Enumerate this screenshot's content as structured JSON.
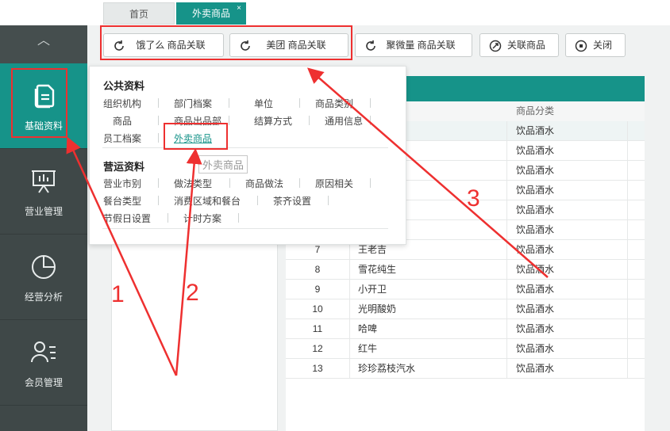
{
  "tabs": {
    "home": "首页",
    "active": "外卖商品",
    "close": "×"
  },
  "sidebar": {
    "collapse": "︿",
    "items": [
      {
        "label": "基础资料"
      },
      {
        "label": "营业管理"
      },
      {
        "label": "经营分析"
      },
      {
        "label": "会员管理"
      }
    ]
  },
  "toolbar": {
    "eleme": "饿了么 商品关联",
    "meituan": "美团 商品关联",
    "juweiliang": "聚微量 商品关联",
    "link_goods": "关联商品",
    "close": "关闭"
  },
  "menu": {
    "public_title": "公共资料",
    "public_row1": [
      "组织机构",
      "部门档案",
      "单位",
      "商品类别"
    ],
    "public_row2": [
      "商品",
      "商品出品部",
      "结算方式",
      "通用信息"
    ],
    "public_row3": [
      "员工档案",
      "外卖商品"
    ],
    "tooltip": "外卖商品",
    "ops_title": "营运资料",
    "ops_row1": [
      "营业市别",
      "做法类型",
      "商品做法",
      "原因相关"
    ],
    "ops_row2": [
      "餐台类型",
      "消费区域和餐台",
      "茶齐设置"
    ],
    "ops_row3": [
      "节假日设置",
      "计时方案"
    ]
  },
  "table": {
    "col_category": "商品分类",
    "rows": [
      {
        "num": "",
        "name": "",
        "cat": "饮品酒水"
      },
      {
        "num": "",
        "name": "",
        "cat": "饮品酒水"
      },
      {
        "num": "",
        "name": "",
        "cat": "饮品酒水"
      },
      {
        "num": "",
        "name": "",
        "cat": "饮品酒水"
      },
      {
        "num": "",
        "name": "",
        "cat": "饮品酒水"
      },
      {
        "num": "",
        "name": "",
        "cat": "饮品酒水"
      },
      {
        "num": "7",
        "name": "王老吉",
        "cat": "饮品酒水"
      },
      {
        "num": "8",
        "name": "雪花纯生",
        "cat": "饮品酒水"
      },
      {
        "num": "9",
        "name": "小开卫",
        "cat": "饮品酒水"
      },
      {
        "num": "10",
        "name": "光明酸奶",
        "cat": "饮品酒水"
      },
      {
        "num": "11",
        "name": "哈啤",
        "cat": "饮品酒水"
      },
      {
        "num": "12",
        "name": "红牛",
        "cat": "饮品酒水"
      },
      {
        "num": "13",
        "name": "珍珍荔枝汽水",
        "cat": "饮品酒水"
      }
    ]
  },
  "annotations": {
    "n1": "1",
    "n2": "2",
    "n3": "3",
    "color": "#ee3030"
  },
  "colors": {
    "accent": "#169389",
    "sidebar": "#3f4848"
  }
}
